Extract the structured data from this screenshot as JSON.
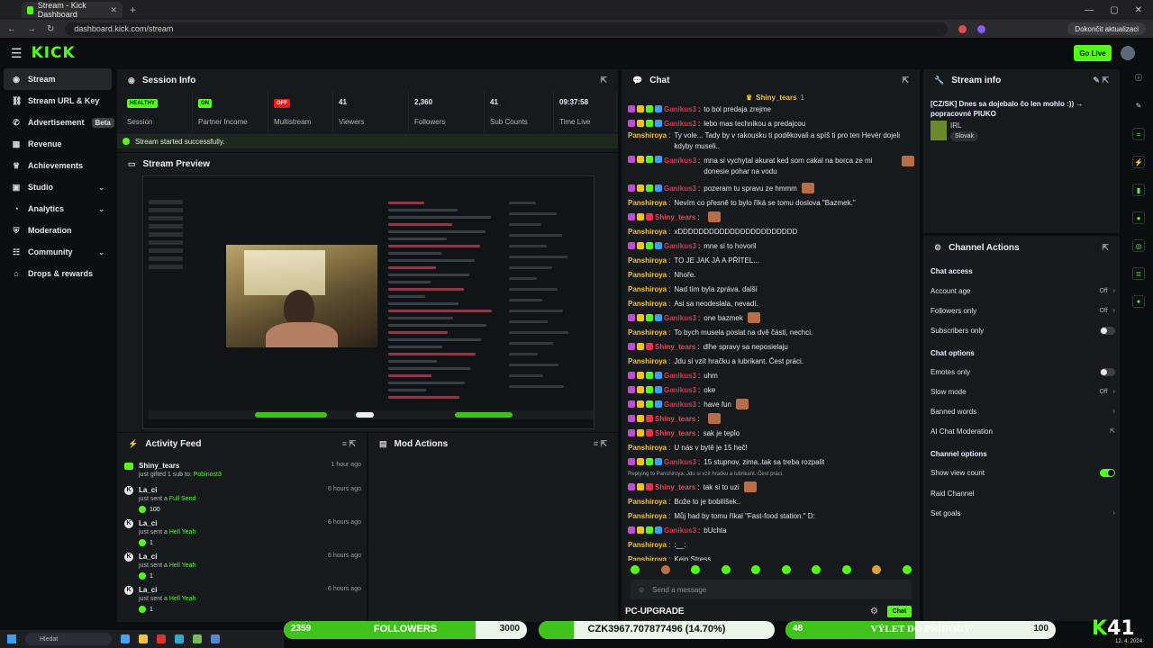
{
  "browser": {
    "tab_title": "Stream - Kick Dashboard",
    "url": "dashboard.kick.com/stream",
    "update_label": "Dokončit aktualizaci"
  },
  "header": {
    "logo": "KICK",
    "go_live": "Go Live"
  },
  "sidebar": {
    "items": [
      {
        "label": "Stream",
        "icon": "broadcast-icon"
      },
      {
        "label": "Stream URL & Key",
        "icon": "link-icon"
      },
      {
        "label": "Advertisement",
        "icon": "megaphone-icon",
        "badge": "Beta"
      },
      {
        "label": "Revenue",
        "icon": "revenue-icon"
      },
      {
        "label": "Achievements",
        "icon": "trophy-icon"
      },
      {
        "label": "Studio",
        "icon": "studio-icon"
      },
      {
        "label": "Analytics",
        "icon": "analytics-icon"
      },
      {
        "label": "Moderation",
        "icon": "shield-icon"
      },
      {
        "label": "Community",
        "icon": "community-icon"
      },
      {
        "label": "Drops & rewards",
        "icon": "gift-icon"
      }
    ]
  },
  "session": {
    "title": "Session Info",
    "stats": [
      {
        "value": "HEALTHY",
        "label": "Session",
        "kind": "badge-green"
      },
      {
        "value": "ON",
        "label": "Partner Income",
        "kind": "badge-green"
      },
      {
        "value": "OFF",
        "label": "Multistream",
        "kind": "badge-red"
      },
      {
        "value": "41",
        "label": "Viewers"
      },
      {
        "value": "2,360",
        "label": "Followers"
      },
      {
        "value": "41",
        "label": "Sub Counts"
      },
      {
        "value": "09:37:58",
        "label": "Time Live"
      }
    ],
    "status": "Stream started successfully."
  },
  "preview": {
    "title": "Stream Preview"
  },
  "activity": {
    "title": "Activity Feed",
    "items": [
      {
        "name": "Shiny_tears",
        "action_pre": "just gifted 1 sub to:",
        "action_hl": "Pobinost3",
        "time": "1 hour ago",
        "amount": ""
      },
      {
        "name": "La_ci",
        "action_pre": "just sent a",
        "action_hl": "Full Send",
        "time": "6 hours ago",
        "amount": "100"
      },
      {
        "name": "La_ci",
        "action_pre": "just sent a",
        "action_hl": "Hell Yeah",
        "time": "6 hours ago",
        "amount": "1"
      },
      {
        "name": "La_ci",
        "action_pre": "just sent a",
        "action_hl": "Hell Yeah",
        "time": "6 hours ago",
        "amount": "1"
      },
      {
        "name": "La_ci",
        "action_pre": "just sent a",
        "action_hl": "Hell Yeah",
        "time": "6 hours ago",
        "amount": "1"
      }
    ]
  },
  "mod": {
    "title": "Mod Actions"
  },
  "chat": {
    "title": "Chat",
    "pinned_user": "Shiny_tears",
    "pinned_count": "1",
    "messages": [
      {
        "u": "Ganikus3",
        "c": "gan",
        "t": "to bol predaja zrejme"
      },
      {
        "u": "Ganikus3",
        "c": "gan",
        "t": "lebo mas technikou a predajcou"
      },
      {
        "u": "Panshiroya",
        "c": "pan",
        "t": "Ty vole... Tady by v rakousku ti poděkovali a spíš ti pro ten Hevér dojeli kdyby museli..",
        "two": true
      },
      {
        "u": "Ganikus3",
        "c": "gan",
        "t": "mna si vychytal akurat ked som cakal na borca ze mi donesie pohar na vodu",
        "two": true,
        "emo": true
      },
      {
        "u": "Ganikus3",
        "c": "gan",
        "t": "pozeram tu spravu ze hmmm",
        "emo": true
      },
      {
        "u": "Panshiroya",
        "c": "pan",
        "t": "Nevím co přesně to bylo říká se tomu doslova \"Bazmek.\""
      },
      {
        "u": "Shiny_tears",
        "c": "shi",
        "t": "",
        "emo": true
      },
      {
        "u": "Panshiroya",
        "c": "pan",
        "t": "xDDDDDDDDDDDDDDDDDDDDDDD"
      },
      {
        "u": "Ganikus3",
        "c": "gan",
        "t": "mne si to hovoril"
      },
      {
        "u": "Panshiroya",
        "c": "pan",
        "t": "TO JE JAK JÁ A PŘÍTEL..."
      },
      {
        "u": "Panshiroya",
        "c": "pan",
        "t": "Nhoře."
      },
      {
        "u": "Panshiroya",
        "c": "pan",
        "t": "Nad tím byla zpráva. další"
      },
      {
        "u": "Panshiroya",
        "c": "pan",
        "t": "Asi sa neodeslala, nevadí."
      },
      {
        "u": "Ganikus3",
        "c": "gan",
        "t": "one bazmek",
        "emo": true
      },
      {
        "u": "Panshiroya",
        "c": "pan",
        "t": "To bych musela poslat na dvě části, nechci."
      },
      {
        "u": "Shiny_tears",
        "c": "shi",
        "t": "dlhe spravy sa neposielaju"
      },
      {
        "u": "Panshiroya",
        "c": "pan",
        "t": "Jdu si vzít hračku a lubrikant. Čest práci."
      },
      {
        "u": "Ganikus3",
        "c": "gan",
        "t": "uhm"
      },
      {
        "u": "Ganikus3",
        "c": "gan",
        "t": "oke"
      },
      {
        "u": "Ganikus3",
        "c": "gan",
        "t": "have fun",
        "emo": true
      },
      {
        "u": "Shiny_tears",
        "c": "shi",
        "t": "",
        "emo": true
      },
      {
        "u": "Shiny_tears",
        "c": "shi",
        "t": "sak je teplo"
      },
      {
        "u": "Panshiroya",
        "c": "pan",
        "t": "U nás v bytě je 15 heč!"
      },
      {
        "u": "Ganikus3",
        "c": "gan",
        "t": "15 stupnov, zima..tak sa treba rozpalit"
      },
      {
        "reply": "Replying to Panshiroya: Jdu si vzít hračku a lubrikant. Čest práci."
      },
      {
        "u": "Shiny_tears",
        "c": "shi",
        "t": "tak si to uzi",
        "emo": true
      },
      {
        "u": "Panshiroya",
        "c": "pan",
        "t": "Bože to je bobilíšek.."
      },
      {
        "u": "Panshiroya",
        "c": "pan",
        "t": "Můj had by tomu říkal \"Fast-food station.\" D:"
      },
      {
        "u": "Ganikus3",
        "c": "gan",
        "t": "bUchta"
      },
      {
        "u": "Panshiroya",
        "c": "pan",
        "t": ":__:"
      },
      {
        "u": "Panshiroya",
        "c": "pan",
        "t": "Kein Stress"
      }
    ],
    "input_placeholder": "Send a message",
    "send_label": "Chat"
  },
  "stream_info": {
    "title": "Stream info",
    "stream_title": "[CZ/SK] Dnes sa dojebalo čo len mohlo :)) → popracovné PIUKO",
    "category": "IRL",
    "language": "Slovak"
  },
  "channel_actions": {
    "title": "Channel Actions",
    "chat_access": "Chat access",
    "account_age": "Account age",
    "account_age_val": "Off",
    "followers_only": "Followers only",
    "followers_only_val": "Off",
    "subscribers_only": "Subscribers only",
    "chat_options": "Chat options",
    "emotes_only": "Emotes only",
    "slow_mode": "Slow mode",
    "slow_mode_val": "Off",
    "banned_words": "Banned words",
    "ai_mod": "AI Chat Moderation",
    "channel_options": "Channel options",
    "show_view_count": "Show view count",
    "raid_channel": "Raid Channel",
    "set_goals": "Set goals"
  },
  "overlay": {
    "upgrade_label": "PC-UPGRADE",
    "followers_bar": {
      "current": "2359",
      "label": "FOLLOWERS",
      "target": "3000",
      "fraction": 0.79
    },
    "upgrade_bar": {
      "label": "CZK3967.707877496 (14.70%)",
      "fraction": 0.147
    },
    "trip_bar": {
      "current": "48",
      "label": "VÝLET DO PŘÍRODY",
      "target": "100",
      "fraction": 0.48
    },
    "viewer_count": "41",
    "logo": "K"
  },
  "taskbar": {
    "search_placeholder": "Hledat",
    "date": "12. 4. 2024"
  },
  "colors": {
    "accent": "#53fc18",
    "panel": "#161a1d",
    "bg": "#0b0e10"
  }
}
